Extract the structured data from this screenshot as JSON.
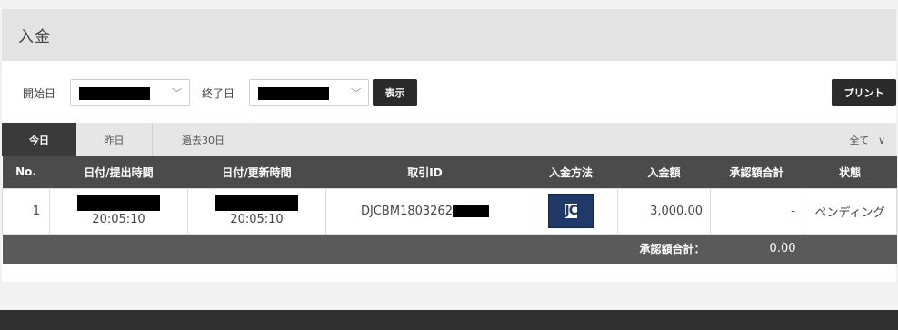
{
  "header": {
    "title": "入金"
  },
  "filter": {
    "start_label": "開始日",
    "end_label": "終了日",
    "show_button": "表示",
    "print_button": "プリント"
  },
  "tabs": [
    {
      "label": "今日",
      "active": true
    },
    {
      "label": "昨日",
      "active": false
    },
    {
      "label": "過去30日",
      "active": false
    }
  ],
  "status_filter": {
    "value": "全て"
  },
  "table": {
    "columns": [
      "No.",
      "日付/提出時間",
      "日付/更新時間",
      "取引ID",
      "入金方法",
      "入金額",
      "承認額合計",
      "状態"
    ],
    "rows": [
      {
        "no": "1",
        "submitted_time": "20:05:10",
        "updated_time": "20:05:10",
        "transaction_id_prefix": "DJCBM1803262",
        "method_logo_text": "JCB",
        "amount": "3,000.00",
        "approved_total": "-",
        "status": "ペンディング"
      }
    ],
    "total_label": "承認額合計：",
    "total_value": "0.00"
  },
  "colors": {
    "header_bg": "#e3e3e3",
    "table_head_bg": "#4b4b4b",
    "total_bg": "#5a5a5a",
    "dark_button": "#2b2b2b",
    "jcb_blue": "#1f3a68",
    "footer": "#2f2f2f"
  }
}
